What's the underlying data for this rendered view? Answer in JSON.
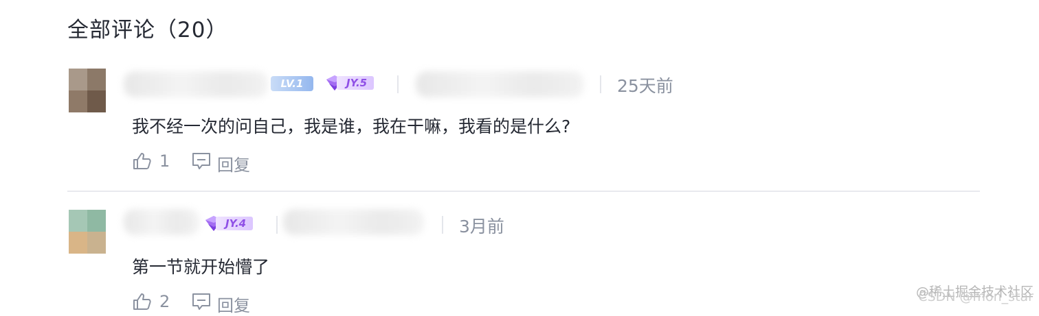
{
  "header": {
    "title": "全部评论（20）"
  },
  "comments": [
    {
      "level_badge": "LV.1",
      "jy_badge": "JY.5",
      "time": "25天前",
      "content": "我不经一次的问自己，我是谁，我在干嘛，我看的是什么?",
      "like_count": "1",
      "reply_label": "回复"
    },
    {
      "jy_badge": "JY.4",
      "time": "3月前",
      "content": "第一节就开始懵了",
      "like_count": "2",
      "reply_label": "回复"
    }
  ],
  "watermark": {
    "line1": "@稀土掘金技术社区",
    "line2": "CSDN @mon_star"
  },
  "colors": {
    "text": "#252933",
    "meta": "#8a919f",
    "jy": "#8f4fe6",
    "lv": "#94b7ee",
    "divider": "#e8e9ee"
  },
  "icons": [
    "like-icon",
    "comment-icon",
    "jy-gem-icon"
  ]
}
